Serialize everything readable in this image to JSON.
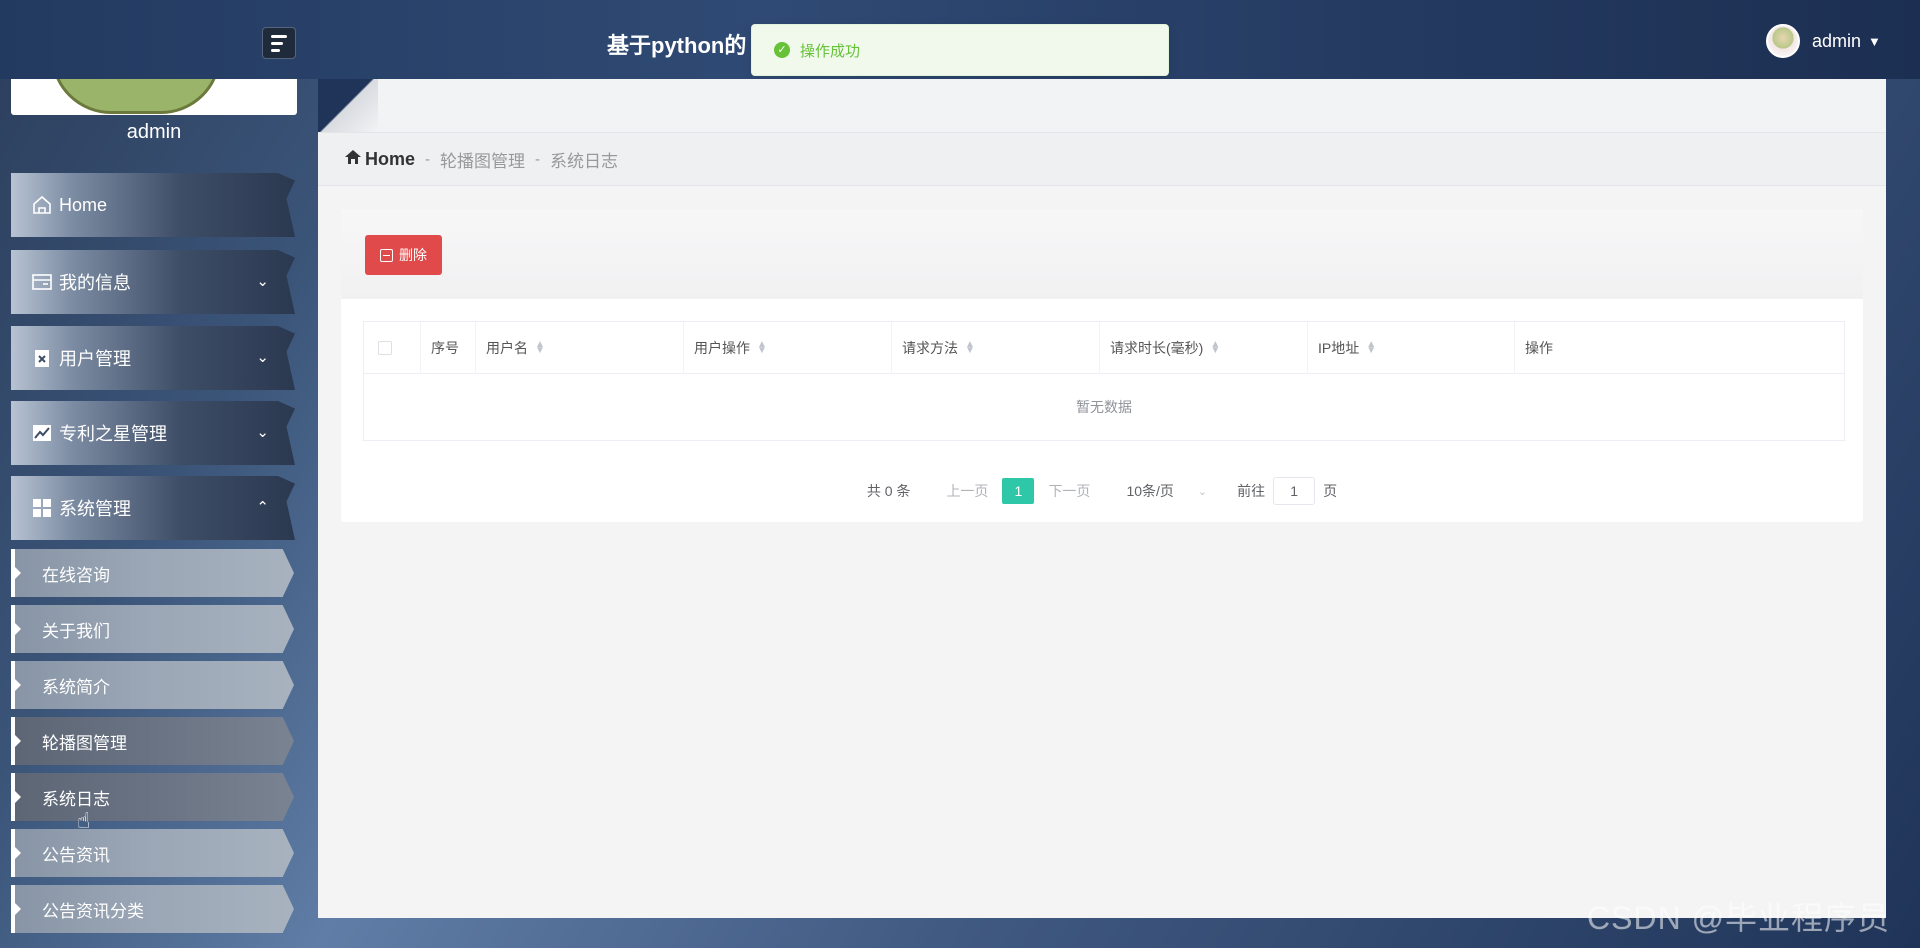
{
  "header": {
    "app_title": "基于python的",
    "toast_message": "操作成功",
    "user_name": "admin"
  },
  "sidebar": {
    "profile_name": "admin",
    "items": [
      {
        "label": "Home",
        "icon": "home-icon"
      },
      {
        "label": "我的信息",
        "icon": "id-card-icon"
      },
      {
        "label": "用户管理",
        "icon": "clipboard-icon"
      },
      {
        "label": "专利之星管理",
        "icon": "chart-icon"
      },
      {
        "label": "系统管理",
        "icon": "grid-icon"
      }
    ],
    "subitems": [
      "在线咨询",
      "关于我们",
      "系统简介",
      "轮播图管理",
      "系统日志",
      "公告资讯",
      "公告资讯分类"
    ]
  },
  "breadcrumb": {
    "home": "Home",
    "sep": "-",
    "level1": "轮播图管理",
    "level2": "系统日志"
  },
  "toolbar": {
    "delete_label": "删除"
  },
  "table": {
    "columns": [
      "序号",
      "用户名",
      "用户操作",
      "请求方法",
      "请求时长(毫秒)",
      "IP地址",
      "操作"
    ],
    "empty_text": "暂无数据"
  },
  "pagination": {
    "total": "共 0 条",
    "prev": "上一页",
    "current": "1",
    "next": "下一页",
    "page_size": "10条/页",
    "goto_label": "前往",
    "goto_value": "1",
    "page_unit": "页"
  },
  "watermark": "CSDN @毕业程序员",
  "colors": {
    "accent": "#2ec7a8",
    "danger": "#e04a4a",
    "success": "#67c23a"
  }
}
